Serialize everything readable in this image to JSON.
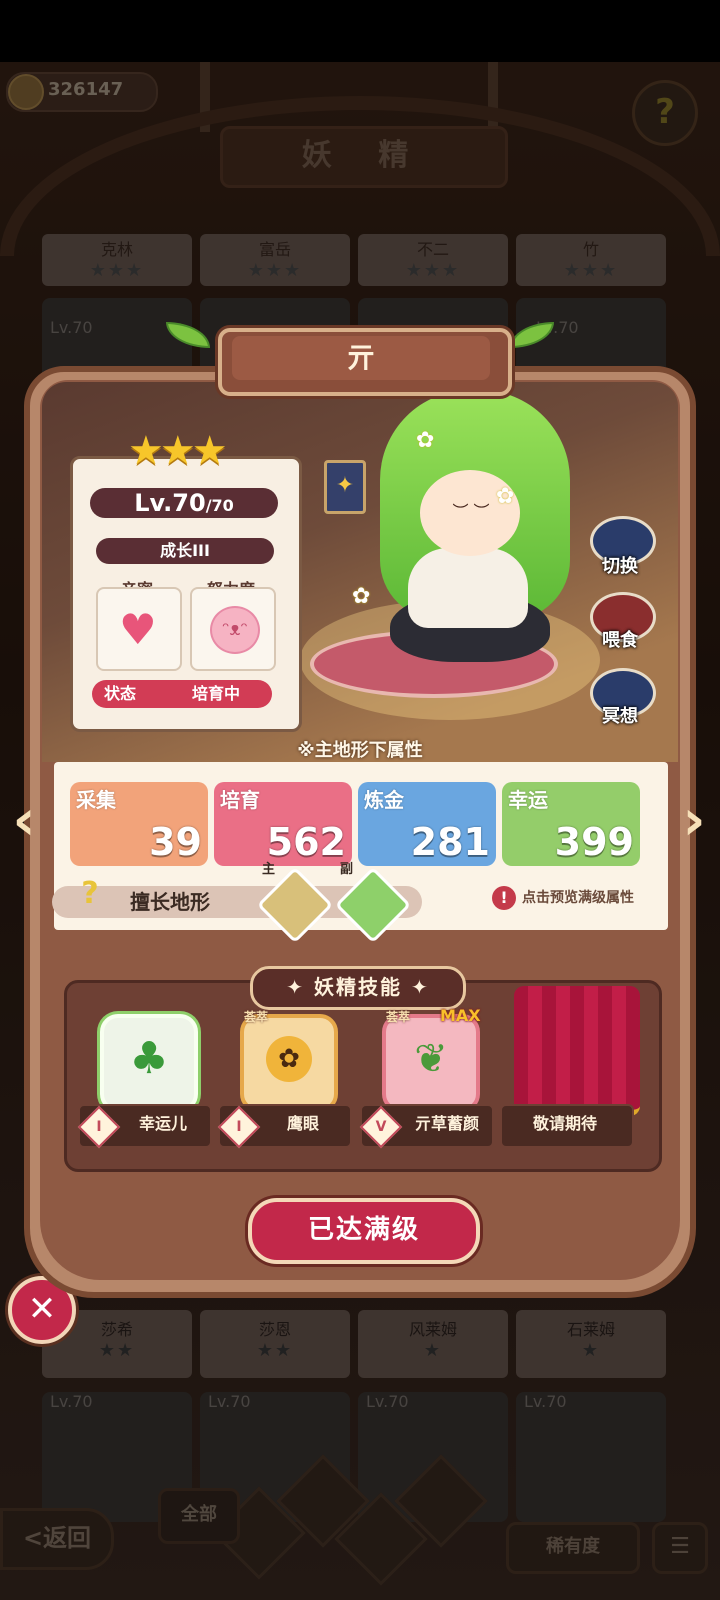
{
  "header": {
    "coin_value": "326147",
    "title": "妖 精",
    "help_icon": "question-flower-icon"
  },
  "background_cards_top": [
    {
      "name": "克林",
      "stars": "★★★"
    },
    {
      "name": "富岳",
      "stars": "★★★"
    },
    {
      "name": "不二",
      "stars": "★★★"
    },
    {
      "name": "竹",
      "stars": "★★★"
    }
  ],
  "background_levels_top": [
    "Lv.70",
    "Lv.70"
  ],
  "background_cards_bottom": [
    {
      "name": "莎希",
      "stars": "★★"
    },
    {
      "name": "莎恩",
      "stars": "★★"
    },
    {
      "name": "风莱姆",
      "stars": "★"
    },
    {
      "name": "石莱姆",
      "stars": "★"
    }
  ],
  "background_levels_bottom": [
    "Lv.70",
    "Lv.70",
    "Lv.70",
    "Lv.70"
  ],
  "bottom_bar": {
    "back_label": "<返回",
    "all_tab": "全部",
    "rarity_label": "稀有度",
    "list_icon": "list-icon"
  },
  "fairy": {
    "name": "亓",
    "stars": "★★★",
    "level": "Lv.70",
    "level_max": "/70",
    "growth": "成长III",
    "intimacy_label": "亲密",
    "effort_label": "努力度",
    "status_label": "状态",
    "status_value": "培育中"
  },
  "side_actions": [
    {
      "label": "切换",
      "icon": "switch-icon"
    },
    {
      "label": "喂食",
      "icon": "meat-icon"
    },
    {
      "label": "冥想",
      "icon": "meditate-icon"
    }
  ],
  "attributes": {
    "title": "※主地形下属性",
    "stats": [
      {
        "label": "采集",
        "value": "39",
        "color": "#f2a37a"
      },
      {
        "label": "培育",
        "value": "562",
        "color": "#ea6f86"
      },
      {
        "label": "炼金",
        "value": "281",
        "color": "#6aa6e0"
      },
      {
        "label": "幸运",
        "value": "399",
        "color": "#94cd6a"
      }
    ],
    "terrain_label": "擅长地形",
    "terrain_main": "主",
    "terrain_sub": "副",
    "hint": "点击预览满级属性"
  },
  "skills": {
    "title": "妖精技能",
    "items": [
      {
        "name": "幸运儿",
        "tier": "I",
        "tag": ""
      },
      {
        "name": "鹰眼",
        "tier": "I",
        "tag": "荟萃"
      },
      {
        "name": "亓草蓄颜",
        "tier": "V",
        "tag": "荟萃"
      },
      {
        "name": "敬请期待",
        "tier": "",
        "tag": ""
      }
    ],
    "max_tag": "MAX"
  },
  "max_button": "已达满级",
  "colors": {
    "accent_red": "#c2284a",
    "panel_brown": "#8f5a44",
    "gold": "#f7c62a"
  }
}
